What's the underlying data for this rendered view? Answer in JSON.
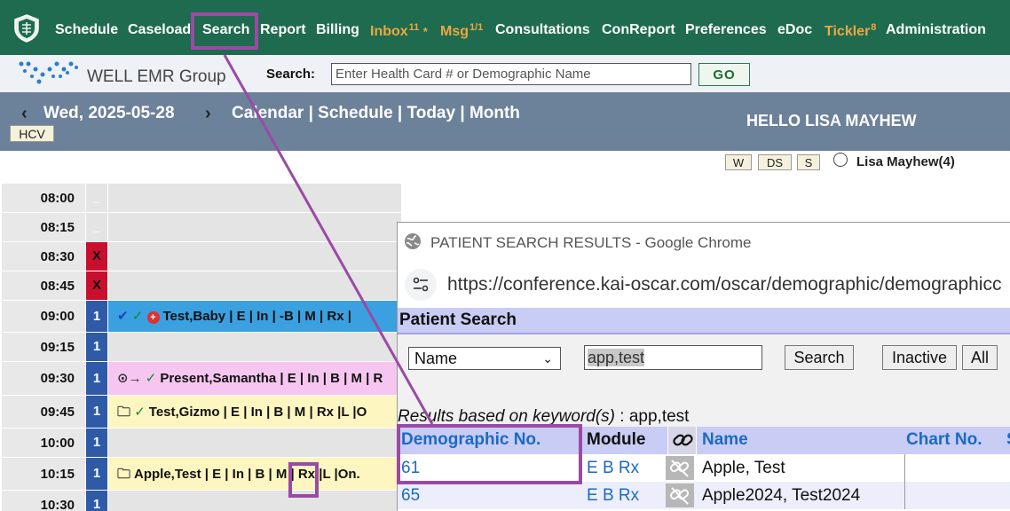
{
  "nav": {
    "items": [
      {
        "label": "Schedule",
        "badge": ""
      },
      {
        "label": "Caseload",
        "badge": ""
      },
      {
        "label": "Search",
        "badge": ""
      },
      {
        "label": "Report",
        "badge": ""
      },
      {
        "label": "Billing",
        "badge": ""
      },
      {
        "label": "Inbox",
        "badge": "11",
        "suffix": "*"
      },
      {
        "label": "Msg",
        "badge": "1/1"
      },
      {
        "label": "Consultations",
        "badge": ""
      },
      {
        "label": "ConReport",
        "badge": ""
      },
      {
        "label": "Preferences",
        "badge": ""
      },
      {
        "label": "eDoc",
        "badge": ""
      },
      {
        "label": "Tickler",
        "badge": "8"
      },
      {
        "label": "Administration",
        "badge": ""
      }
    ],
    "accent_color": "#f0a640",
    "bg_color": "#1e6b50"
  },
  "brand": {
    "name": "WELL EMR Group"
  },
  "search": {
    "label": "Search:",
    "placeholder": "Enter Health Card # or Demographic Name",
    "go_label": "GO"
  },
  "datebar": {
    "date": "Wed, 2025-05-28",
    "links": "Calendar | Schedule | Today | Month",
    "hello": "HELLO LISA MAYHEW",
    "hcv_label": "HCV"
  },
  "views": {
    "buttons": [
      "W",
      "DS",
      "S"
    ],
    "provider": "Lisa Mayhew(4)"
  },
  "schedule": {
    "rows": [
      {
        "time": "08:00",
        "mark": "_",
        "mark_color": "grey",
        "appt": "",
        "bg": "#e4e4e4",
        "icon": ""
      },
      {
        "time": "08:15",
        "mark": "_",
        "mark_color": "grey",
        "appt": "",
        "bg": "#e4e4e4",
        "icon": ""
      },
      {
        "time": "08:30",
        "mark": "X",
        "mark_color": "red",
        "appt": "",
        "bg": "#e4e4e4",
        "icon": ""
      },
      {
        "time": "08:45",
        "mark": "X",
        "mark_color": "red",
        "appt": "",
        "bg": "#e4e4e4",
        "icon": ""
      },
      {
        "time": "09:00",
        "mark": "1",
        "mark_color": "blue",
        "appt": "Test,Baby | E | In | -B | M | Rx |",
        "bg": "#3aa0e0",
        "icon": "check-plus"
      },
      {
        "time": "09:15",
        "mark": "1",
        "mark_color": "blue",
        "appt": "",
        "bg": "#e4e4e4",
        "icon": ""
      },
      {
        "time": "09:30",
        "mark": "1",
        "mark_color": "blue",
        "appt": "Present,Samantha | E | In | B | M | R",
        "bg": "#f6c6f0",
        "icon": "arrive"
      },
      {
        "time": "09:45",
        "mark": "1",
        "mark_color": "blue",
        "appt": "Test,Gizmo | E | In | B | M | Rx |L |O",
        "bg": "#fdf6c0",
        "icon": "folder-check"
      },
      {
        "time": "10:00",
        "mark": "1",
        "mark_color": "blue",
        "appt": "",
        "bg": "#e4e4e4",
        "icon": ""
      },
      {
        "time": "10:15",
        "mark": "1",
        "mark_color": "blue",
        "appt": "Apple,Test | E | In | B | M | Rx |L |On.",
        "bg": "#fdf6c0",
        "icon": "folder"
      },
      {
        "time": "10:30",
        "mark": "1",
        "mark_color": "blue",
        "appt": "",
        "bg": "#e4e4e4",
        "icon": ""
      }
    ]
  },
  "popup": {
    "window_title": "PATIENT SEARCH RESULTS - Google Chrome",
    "url": "https://conference.kai-oscar.com/oscar/demographic/demographicc",
    "heading": "Patient Search",
    "search_by": "Name",
    "keyword": "app,test",
    "search_btn": "Search",
    "inactive_btn": "Inactive",
    "all_btn": "All",
    "results_prefix": "Results based on keyword(s)",
    "results_keyword": ": app,test",
    "columns": [
      "Demographic No.",
      "Module",
      "Name",
      "Chart No.",
      "S"
    ],
    "rows": [
      {
        "demo_no": "61",
        "module": "E B Rx",
        "name": "Apple, Test",
        "chart": ""
      },
      {
        "demo_no": "65",
        "module": "E B Rx",
        "name": "Apple2024, Test2024",
        "chart": ""
      }
    ]
  },
  "annotation_color": "#9a4aa5"
}
